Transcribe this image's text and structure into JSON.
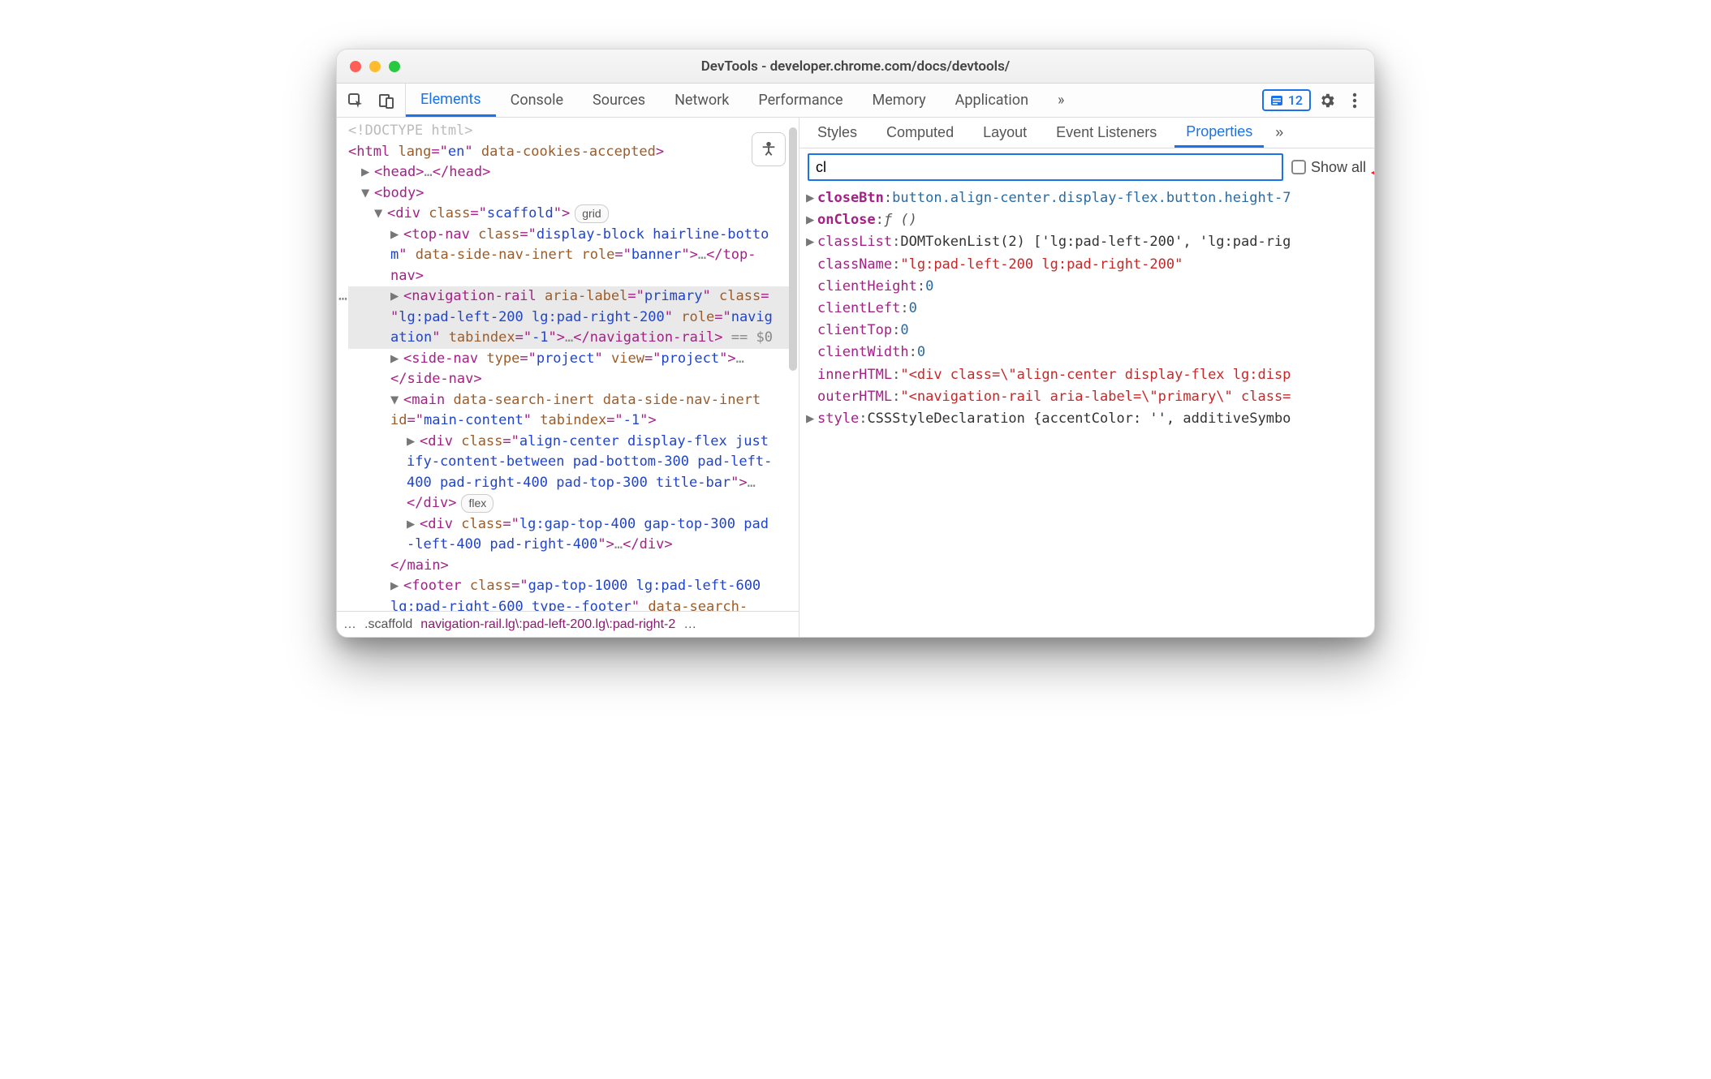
{
  "window": {
    "title": "DevTools - developer.chrome.com/docs/devtools/"
  },
  "toolbar": {
    "tabs": [
      "Elements",
      "Console",
      "Sources",
      "Network",
      "Performance",
      "Memory",
      "Application"
    ],
    "active_tab": "Elements",
    "issues_count": "12"
  },
  "tree": {
    "doctype": "<!DOCTYPE html>",
    "html_open_1": "<",
    "html_tag": "html",
    "html_attrs": " lang=\"en\" data-cookies-accepted",
    "html_close": ">",
    "head": "<head>…</head>",
    "body_open": "<body>",
    "div_scaffold_raw": "<div class=\"scaffold\">",
    "div_scaffold_pill": "grid",
    "topnav_raw_a": "<top-nav class=\"display-block hairline-botto",
    "topnav_raw_b": "m\" data-side-nav-inert role=\"banner\">…</top-",
    "topnav_raw_c": "nav>",
    "navrail_a": "<navigation-rail aria-label=\"primary\" class=",
    "navrail_b": "\"lg:pad-left-200 lg:pad-right-200\" role=\"navig",
    "navrail_c": "ation\" tabindex=\"-1\">…</navigation-rail>",
    "navrail_eq": " == $0",
    "sidenav_a": "<side-nav type=\"project\" view=\"project\">…",
    "sidenav_b": "</side-nav>",
    "main_a": "<main data-search-inert data-side-nav-inert",
    "main_b": "id=\"main-content\" tabindex=\"-1\">",
    "div_align_a": "<div class=\"align-center display-flex just",
    "div_align_b": "ify-content-between pad-bottom-300 pad-left-",
    "div_align_c": "400 pad-right-400 pad-top-300 title-bar\">…",
    "div_align_d": "</div>",
    "flex_pill": "flex",
    "div_gap_a": "<div class=\"lg:gap-top-400 gap-top-300 pad",
    "div_gap_b": "-left-400 pad-right-400\">…</div>",
    "main_close": "</main>",
    "footer_a": "<footer class=\"gap-top-1000 lg:pad-left-600",
    "footer_b": "lg:pad-right-600 type--footer\" data-search-"
  },
  "breadcrumb": {
    "dots": "…",
    "first": ".scaffold",
    "second": "navigation-rail.lg\\:pad-left-200.lg\\:pad-right-2",
    "trail": "…"
  },
  "subtabs": [
    "Styles",
    "Computed",
    "Layout",
    "Event Listeners",
    "Properties"
  ],
  "subtab_active": "Properties",
  "filter": {
    "value": "cl",
    "show_all_label": "Show all"
  },
  "props": {
    "closeBtn_key": "closeBtn",
    "closeBtn_val_el": "button",
    "closeBtn_val_cls": ".align-center.display-flex.button.height-7",
    "onClose_key": "onClose",
    "onClose_val": "ƒ ()",
    "classList_key": "classList",
    "classList_val": "DOMTokenList(2) ['lg:pad-left-200', 'lg:pad-rig",
    "className_key": "className",
    "className_val": "\"lg:pad-left-200 lg:pad-right-200\"",
    "clientHeight_key": "clientHeight",
    "clientHeight_val": "0",
    "clientLeft_key": "clientLeft",
    "clientLeft_val": "0",
    "clientTop_key": "clientTop",
    "clientTop_val": "0",
    "clientWidth_key": "clientWidth",
    "clientWidth_val": "0",
    "innerHTML_key": "innerHTML",
    "innerHTML_val": "\"<div class=\\\"align-center display-flex lg:disp",
    "outerHTML_key": "outerHTML",
    "outerHTML_val": "\"<navigation-rail aria-label=\\\"primary\\\" class=",
    "style_key": "style",
    "style_val": "CSSStyleDeclaration {accentColor: '', additiveSymbo"
  }
}
